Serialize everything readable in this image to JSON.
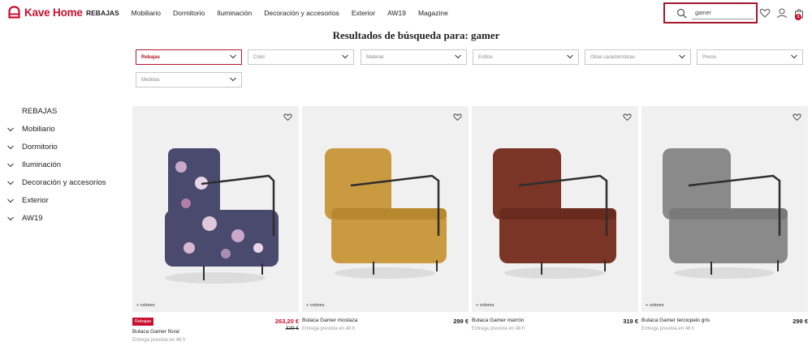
{
  "header": {
    "brand": "Kave Home",
    "nav": [
      "REBAJAS",
      "Mobiliario",
      "Dormitorio",
      "Iluminación",
      "Decoración y accesorios",
      "Exterior",
      "AW19",
      "Magazine"
    ],
    "search_value": "gamer",
    "cart_count": "1"
  },
  "page": {
    "title": "Resultados de búsqueda para: gamer"
  },
  "filters": [
    "Rebajas",
    "Color",
    "Material",
    "Estilos",
    "Otras características",
    "Precio",
    "Medidas"
  ],
  "sidebar": {
    "items": [
      "REBAJAS",
      "Mobiliario",
      "Dormitorio",
      "Iluminación",
      "Decoración y accesorios",
      "Exterior",
      "AW19"
    ]
  },
  "products": [
    {
      "name": "Butaca Gamer floral",
      "price": "263,20 €",
      "old_price": "329 €",
      "badge": "Rebajas",
      "delivery": "Entrega prevista en 48 h",
      "colors_label": "+ colores",
      "color": "#4a4a6e"
    },
    {
      "name": "Butaca Gamer mostaza",
      "price": "299 €",
      "delivery": "Entrega prevista en 48 h",
      "colors_label": "+ colores",
      "color": "#c99a3f"
    },
    {
      "name": "Butaca Gamer marrón",
      "price": "319 €",
      "delivery": "Entrega prevista en 48 h",
      "colors_label": "+ colores",
      "color": "#7a3526"
    },
    {
      "name": "Butaca Gamer terciopelo gris",
      "price": "299 €",
      "delivery": "Entrega prevista en 48 h",
      "colors_label": "+ colores",
      "color": "#8a8a8a"
    }
  ],
  "colors": {
    "brand_red": "#c8102e",
    "search_border": "#a4172e",
    "card_bg": "#f0f0f0"
  }
}
